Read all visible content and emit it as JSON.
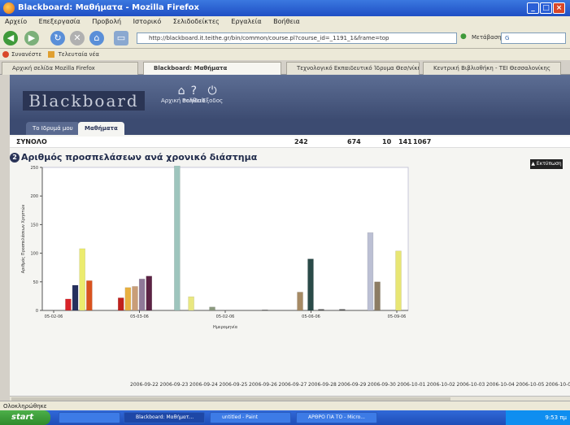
{
  "window": {
    "title": "Blackboard: Μαθήματα - Mozilla Firefox"
  },
  "menu": [
    "Αρχείο",
    "Επεξεργασία",
    "Προβολή",
    "Ιστορικό",
    "Σελιδοδείκτες",
    "Εργαλεία",
    "Βοήθεια"
  ],
  "toolbar": {
    "url": "http://blackboard.it.teithe.gr/bin/common/course.pl?course_id=_1191_1&frame=top",
    "search_placeholder": "Μετάβαση"
  },
  "bookmarks": [
    "Συνανέστε",
    "Τελευταία νέα"
  ],
  "tabs": [
    {
      "label": "Αρχική σελίδα Mozilla Firefox"
    },
    {
      "label": "Blackboard: Μαθήματα"
    },
    {
      "label": "Τεχνολογικό Εκπαιδευτικό Ίδρυμα Θεσ/νίκης"
    },
    {
      "label": "Κεντρική Βιβλιοθήκη - ΤΕΙ Θεσσαλονίκης"
    }
  ],
  "page": {
    "logo_text": "Blackboard",
    "header_icons": [
      "Αρχική σελίδα",
      "Βοήθεια",
      "Έξοδος"
    ],
    "subtabs": [
      "Το Ιδρυμά μου",
      "Μαθήματα"
    ],
    "total_row": {
      "label": "ΣΥΝΟΛΟ",
      "values": [
        "242",
        "674",
        "10",
        "141",
        "1067"
      ]
    },
    "section_number": "2",
    "section_title": "Αριθμός προσπελάσεων ανά χρονικό διάστημα",
    "export_label": "▲ Εκτύπωση",
    "date_labels": [
      "2006-09-22",
      "2006-09-23",
      "2006-09-24",
      "2006-09-25",
      "2006-09-26",
      "2006-09-27",
      "2006-09-28",
      "2006-09-29",
      "2006-09-30",
      "2006-10-01",
      "2006-10-02",
      "2006-10-03",
      "2006-10-04",
      "2006-10-05",
      "2006-10-06"
    ]
  },
  "chart_data": {
    "type": "bar",
    "title": "",
    "xlabel": "Ημερομηνία",
    "ylabel": "Αριθμός Προσπελάσεων Χρηστών",
    "ylim": [
      0,
      250
    ],
    "yticks": [
      0,
      50,
      100,
      150,
      200,
      250
    ],
    "xticks": [
      "05-02-06",
      "05-03-06",
      "05-02-06",
      "05-06-06",
      "05-09-06"
    ],
    "grid": false,
    "bars": [
      {
        "x": 0.06,
        "value": 20,
        "color": "#d9242a"
      },
      {
        "x": 0.08,
        "value": 44,
        "color": "#25305e"
      },
      {
        "x": 0.1,
        "value": 108,
        "color": "#ecec6e"
      },
      {
        "x": 0.12,
        "value": 52,
        "color": "#d9521e"
      },
      {
        "x": 0.21,
        "value": 22,
        "color": "#c0201c"
      },
      {
        "x": 0.23,
        "value": 40,
        "color": "#e8b040"
      },
      {
        "x": 0.25,
        "value": 42,
        "color": "#c99e78"
      },
      {
        "x": 0.27,
        "value": 55,
        "color": "#8f7898"
      },
      {
        "x": 0.29,
        "value": 60,
        "color": "#5c2344"
      },
      {
        "x": 0.37,
        "value": 256,
        "color": "#9ec5bd"
      },
      {
        "x": 0.41,
        "value": 24,
        "color": "#e9e780"
      },
      {
        "x": 0.47,
        "value": 6,
        "color": "#8c9a80"
      },
      {
        "x": 0.62,
        "value": 1,
        "color": "#555"
      },
      {
        "x": 0.72,
        "value": 32,
        "color": "#a68a64"
      },
      {
        "x": 0.75,
        "value": 90,
        "color": "#2a4a48"
      },
      {
        "x": 0.78,
        "value": 2,
        "color": "#555"
      },
      {
        "x": 0.84,
        "value": 2,
        "color": "#555"
      },
      {
        "x": 0.92,
        "value": 136,
        "color": "#bcc0d4"
      },
      {
        "x": 0.94,
        "value": 50,
        "color": "#8c7c64"
      },
      {
        "x": 1.0,
        "value": 104,
        "color": "#e8e674"
      }
    ]
  },
  "statusbar": {
    "text": "Ολοκληρώθηκε"
  },
  "taskbar": {
    "start": "start",
    "tasks": [
      "",
      "Blackboard: Μαθήματ...",
      "untitled - Paint",
      "ΑΡΘΡΟ ΓΙΑ ΤΟ - Micro..."
    ],
    "clock": "9:53 πμ"
  },
  "colors": {
    "xp_blue": "#1f4fc4",
    "bb_header": "#3c4b71",
    "start_green": "#2f8a2c"
  }
}
